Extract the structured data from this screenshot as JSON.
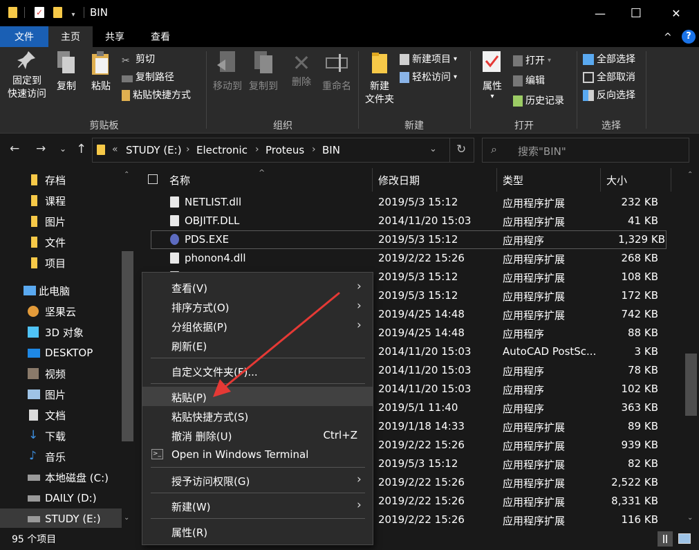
{
  "window": {
    "title": "BIN",
    "minimize": "—",
    "maximize": "☐",
    "close": "✕"
  },
  "ribbon_tabs": {
    "file": "文件",
    "home": "主页",
    "share": "共享",
    "view": "查看",
    "help": "?",
    "collapse": "^"
  },
  "ribbon": {
    "clipboard": {
      "pin_line1": "固定到",
      "pin_line2": "快速访问",
      "copy": "复制",
      "paste": "粘贴",
      "cut": "剪切",
      "copy_path": "复制路径",
      "paste_shortcut": "粘贴快捷方式",
      "group": "剪贴板"
    },
    "organize": {
      "move_to": "移动到",
      "copy_to": "复制到",
      "delete": "删除",
      "rename": "重命名",
      "group": "组织"
    },
    "new": {
      "new_folder_line1": "新建",
      "new_folder_line2": "文件夹",
      "new_item": "新建项目",
      "easy_access": "轻松访问",
      "group": "新建"
    },
    "open": {
      "properties": "属性",
      "open": "打开",
      "edit": "编辑",
      "history": "历史记录",
      "group": "打开"
    },
    "select": {
      "select_all": "全部选择",
      "select_none": "全部取消",
      "invert": "反向选择",
      "group": "选择"
    }
  },
  "address": {
    "drive": "STUDY (E:)",
    "folder1": "Electronic",
    "folder2": "Proteus",
    "folder3": "BIN",
    "overflow": "«"
  },
  "search": {
    "placeholder": "搜索\"BIN\""
  },
  "nav_pane": {
    "items": [
      {
        "label": "存档"
      },
      {
        "label": "课程"
      },
      {
        "label": "图片"
      },
      {
        "label": "文件"
      },
      {
        "label": "项目"
      },
      {
        "label": "此电脑"
      },
      {
        "label": "坚果云"
      },
      {
        "label": "3D 对象"
      },
      {
        "label": "DESKTOP"
      },
      {
        "label": "视频"
      },
      {
        "label": "图片"
      },
      {
        "label": "文档"
      },
      {
        "label": "下载"
      },
      {
        "label": "音乐"
      },
      {
        "label": "本地磁盘 (C:)"
      },
      {
        "label": "DAILY (D:)"
      },
      {
        "label": "STUDY (E:)"
      }
    ]
  },
  "columns": {
    "name": "名称",
    "date": "修改日期",
    "type": "类型",
    "size": "大小"
  },
  "files": [
    {
      "name": "NETLIST.dll",
      "date": "2019/5/3 15:12",
      "type": "应用程序扩展",
      "size": "232 KB"
    },
    {
      "name": "OBJITF.DLL",
      "date": "2014/11/20 15:03",
      "type": "应用程序扩展",
      "size": "41 KB"
    },
    {
      "name": "PDS.EXE",
      "date": "2019/5/3 15:12",
      "type": "应用程序",
      "size": "1,329 KB"
    },
    {
      "name": "phonon4.dll",
      "date": "2019/2/22 15:26",
      "type": "应用程序扩展",
      "size": "268 KB"
    },
    {
      "name": "",
      "date": "2019/5/3 15:12",
      "type": "应用程序扩展",
      "size": "108 KB"
    },
    {
      "name": "",
      "date": "2019/5/3 15:12",
      "type": "应用程序扩展",
      "size": "172 KB"
    },
    {
      "name": "",
      "date": "2019/4/25 14:48",
      "type": "应用程序扩展",
      "size": "742 KB"
    },
    {
      "name": "",
      "date": "2019/4/25 14:48",
      "type": "应用程序",
      "size": "88 KB"
    },
    {
      "name": "",
      "date": "2014/11/20 15:03",
      "type": "AutoCAD PostSc...",
      "size": "3 KB"
    },
    {
      "name": "",
      "date": "2014/11/20 15:03",
      "type": "应用程序",
      "size": "78 KB"
    },
    {
      "name": "",
      "date": "2014/11/20 15:03",
      "type": "应用程序",
      "size": "102 KB"
    },
    {
      "name": "",
      "date": "2019/5/1 11:40",
      "type": "应用程序",
      "size": "363 KB"
    },
    {
      "name": "",
      "date": "2019/1/18 14:33",
      "type": "应用程序扩展",
      "size": "89 KB"
    },
    {
      "name": "",
      "date": "2019/2/22 15:26",
      "type": "应用程序扩展",
      "size": "939 KB"
    },
    {
      "name": "",
      "date": "2019/5/3 15:12",
      "type": "应用程序扩展",
      "size": "82 KB"
    },
    {
      "name": "",
      "date": "2019/2/22 15:26",
      "type": "应用程序扩展",
      "size": "2,522 KB"
    },
    {
      "name": "",
      "date": "2019/2/22 15:26",
      "type": "应用程序扩展",
      "size": "8,331 KB"
    },
    {
      "name": "",
      "date": "2019/2/22 15:26",
      "type": "应用程序扩展",
      "size": "116 KB"
    }
  ],
  "status": {
    "count": "95 个项目"
  },
  "context_menu": {
    "view": "查看(V)",
    "sort": "排序方式(O)",
    "group": "分组依据(P)",
    "refresh": "刷新(E)",
    "customize": "自定义文件夹(F)...",
    "paste": "粘贴(P)",
    "paste_shortcut": "粘贴快捷方式(S)",
    "undo": "撤消 删除(U)",
    "undo_shortcut": "Ctrl+Z",
    "terminal": "Open in Windows Terminal",
    "grant": "授予访问权限(G)",
    "new": "新建(W)",
    "properties": "属性(R)"
  },
  "colors": {
    "accent": "#1a5fb4",
    "folder": "#f7c948",
    "annotation_arrow": "#e53935",
    "background": "#191919"
  }
}
